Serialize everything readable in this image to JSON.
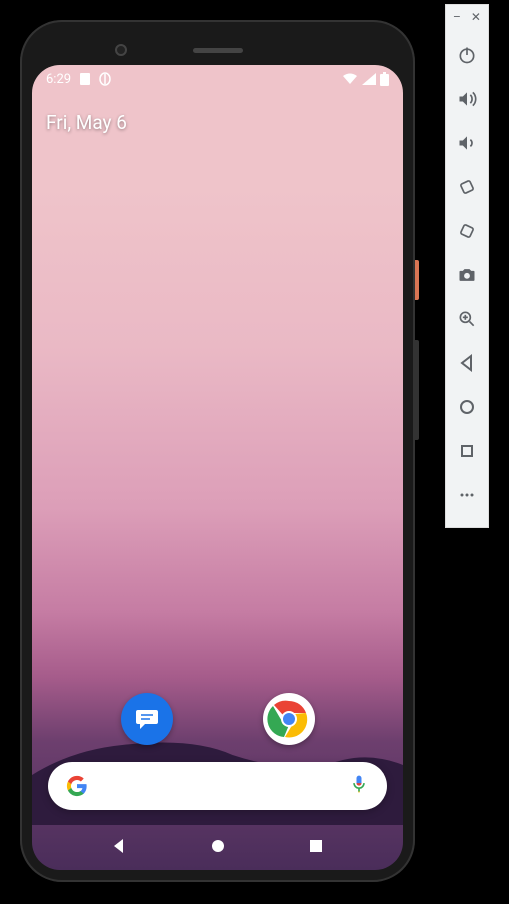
{
  "status": {
    "time": "6:29",
    "icons_left": [
      "clipboard-icon",
      "pill-icon"
    ],
    "icons_right": [
      "wifi-icon",
      "signal-icon",
      "battery-icon"
    ]
  },
  "date": "Fri, May 6",
  "dock_apps": [
    {
      "name": "messages-icon",
      "label": "Messages"
    },
    {
      "name": "chrome-icon",
      "label": "Chrome"
    }
  ],
  "search": {
    "provider": "Google",
    "placeholder": ""
  },
  "nav": {
    "back": "Back",
    "home": "Home",
    "recents": "Recents"
  },
  "toolbar": {
    "minimize": "–",
    "close": "✕",
    "buttons": [
      {
        "name": "power-icon",
        "label": "Power"
      },
      {
        "name": "volume-up-icon",
        "label": "Volume Up"
      },
      {
        "name": "volume-down-icon",
        "label": "Volume Down"
      },
      {
        "name": "rotate-left-icon",
        "label": "Rotate Left"
      },
      {
        "name": "rotate-right-icon",
        "label": "Rotate Right"
      },
      {
        "name": "camera-icon",
        "label": "Screenshot"
      },
      {
        "name": "zoom-icon",
        "label": "Zoom"
      },
      {
        "name": "back-icon",
        "label": "Back"
      },
      {
        "name": "home-icon",
        "label": "Home"
      },
      {
        "name": "overview-icon",
        "label": "Overview"
      },
      {
        "name": "more-icon",
        "label": "More"
      }
    ]
  }
}
